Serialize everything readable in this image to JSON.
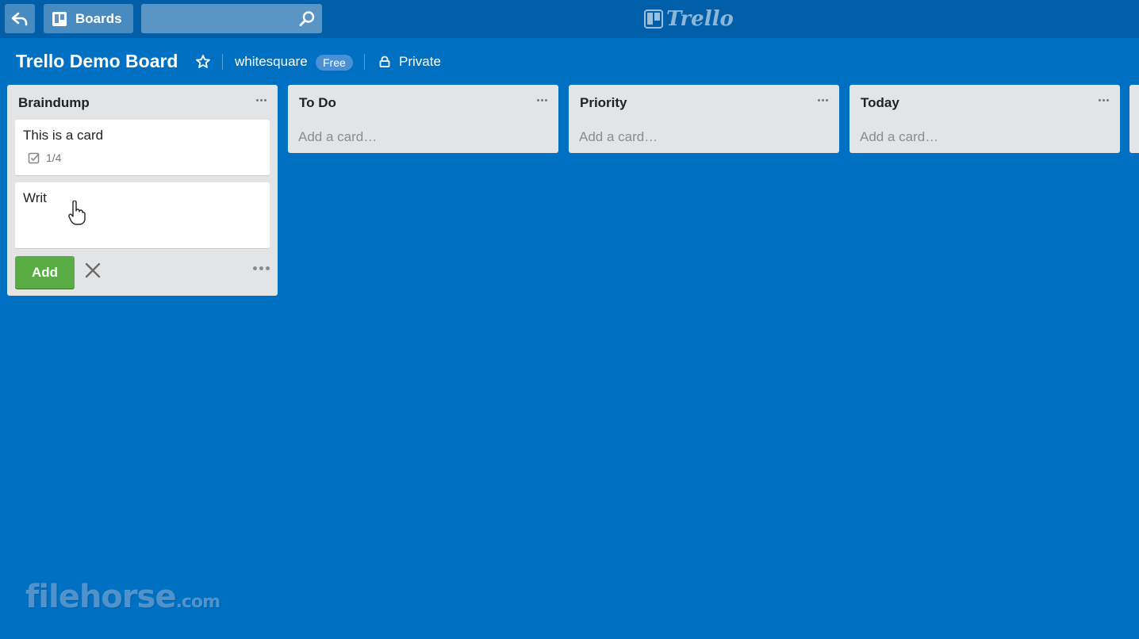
{
  "topbar": {
    "boards_label": "Boards",
    "search_value": "",
    "search_placeholder": "",
    "logo_text": "Trello"
  },
  "board": {
    "title": "Trello Demo Board",
    "team": "whitesquare",
    "team_badge": "Free",
    "privacy": "Private"
  },
  "lists": [
    {
      "title": "Braindump",
      "cards": [
        {
          "title": "This is a card",
          "checklist": "1/4"
        }
      ],
      "composer_value": "Writ",
      "add_label": "Add"
    },
    {
      "title": "To Do",
      "add_card": "Add a card…"
    },
    {
      "title": "Priority",
      "add_card": "Add a card…"
    },
    {
      "title": "Today",
      "add_card": "Add a card…"
    }
  ],
  "watermark": {
    "main": "filehorse",
    "suffix": ".com"
  },
  "colors": {
    "background": "#0070c2",
    "header": "#005fa8",
    "list": "#e2e4e6",
    "add_button": "#5aac44"
  }
}
